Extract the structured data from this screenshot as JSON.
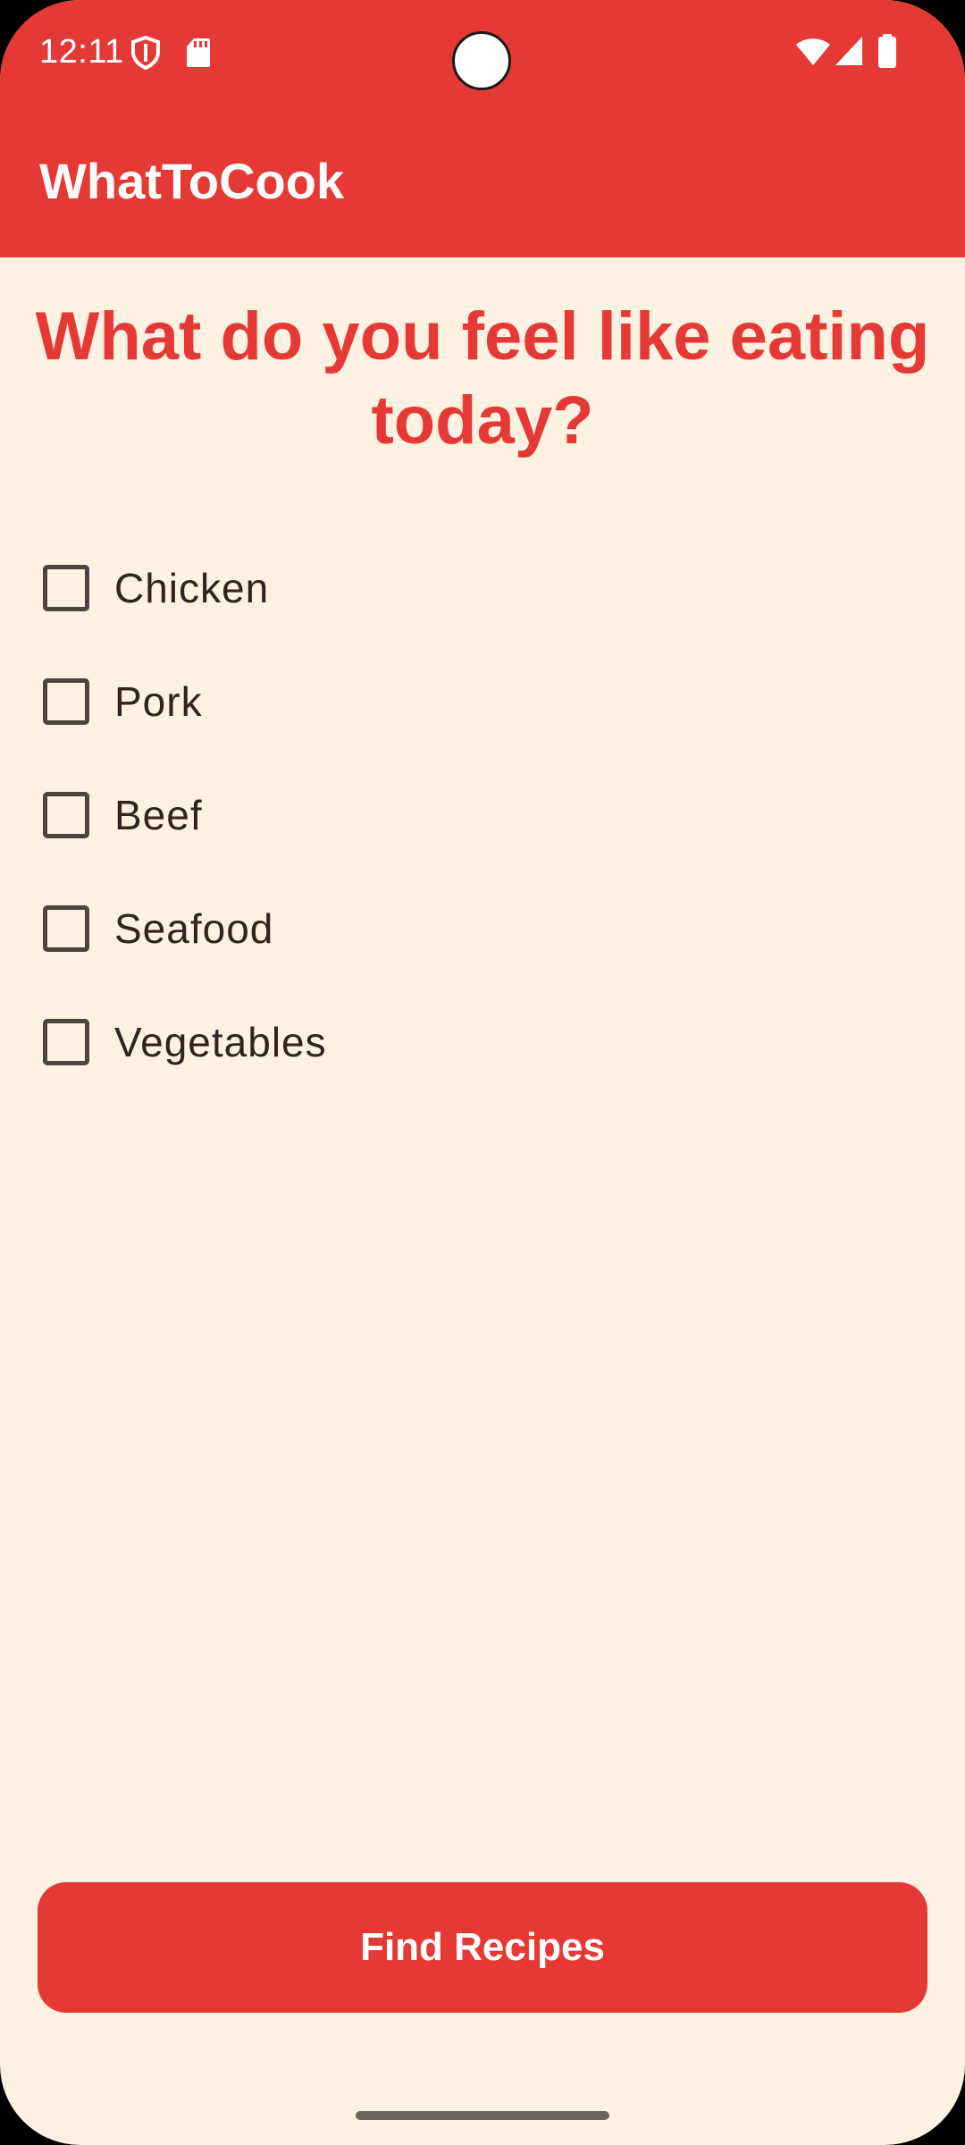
{
  "status_bar": {
    "time": "12:11",
    "icons_left": [
      "shield-icon",
      "sd-card-icon"
    ],
    "icons_right": [
      "wifi-icon",
      "cell-signal-icon",
      "battery-icon"
    ]
  },
  "app_bar": {
    "title": "WhatToCook"
  },
  "main": {
    "heading": "What do you feel like eating today?",
    "options": [
      {
        "label": "Chicken",
        "checked": false
      },
      {
        "label": "Pork",
        "checked": false
      },
      {
        "label": "Beef",
        "checked": false
      },
      {
        "label": "Seafood",
        "checked": false
      },
      {
        "label": "Vegetables",
        "checked": false
      }
    ],
    "find_button_label": "Find Recipes"
  },
  "colors": {
    "primary": "#E53935",
    "background": "#FDF1E1",
    "text": "#2E2521",
    "checkbox_border": "#4A4540"
  }
}
